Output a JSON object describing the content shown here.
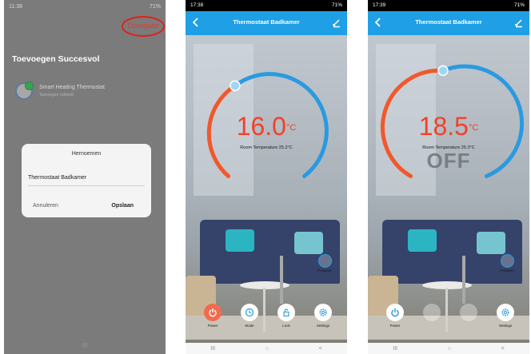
{
  "phone1": {
    "status_time": "11:38",
    "status_right": "71%",
    "next_link": "Doorgaan",
    "heading": "Toevoegen Succesvol",
    "device_name": "Smart Heating Thermostat",
    "device_sub": "Toevoegen voltooid",
    "dialog": {
      "title": "Hernoemen",
      "input_value": "Thermostaat Badkamer",
      "cancel": "Annuleren",
      "save": "Opslaan"
    },
    "nav": [
      "III",
      "○",
      "<"
    ]
  },
  "phone2": {
    "status_time": "17:38",
    "status_right": "71%",
    "title": "Thermostaat Badkamer",
    "setpoint": "16.0",
    "unit": "°C",
    "room_temperature": "Room Temperature 25.2°C",
    "program_label": "Program",
    "controls": [
      "Power",
      "Mode",
      "Lock",
      "Settings"
    ],
    "nav": [
      "III",
      "○",
      "<"
    ],
    "dial_level": 0.1
  },
  "phone3": {
    "status_time": "17:39",
    "status_right": "71%",
    "title": "Thermostaat Badkamer",
    "setpoint": "18.5",
    "unit": "°C",
    "room_temperature": "Room Temperature 25.3°C",
    "off_text": "OFF",
    "program_label": "Program",
    "controls": [
      "Power",
      "Settings"
    ],
    "nav": [
      "III",
      "○",
      "<"
    ],
    "dial_level": 0.3
  },
  "colors": {
    "accent": "#1e9fe6",
    "setpoint_red": "#f2402a",
    "arc_blue": "#2a9ae0",
    "arc_orange": "#f1582b",
    "highlight_circle": "#e0201b"
  }
}
